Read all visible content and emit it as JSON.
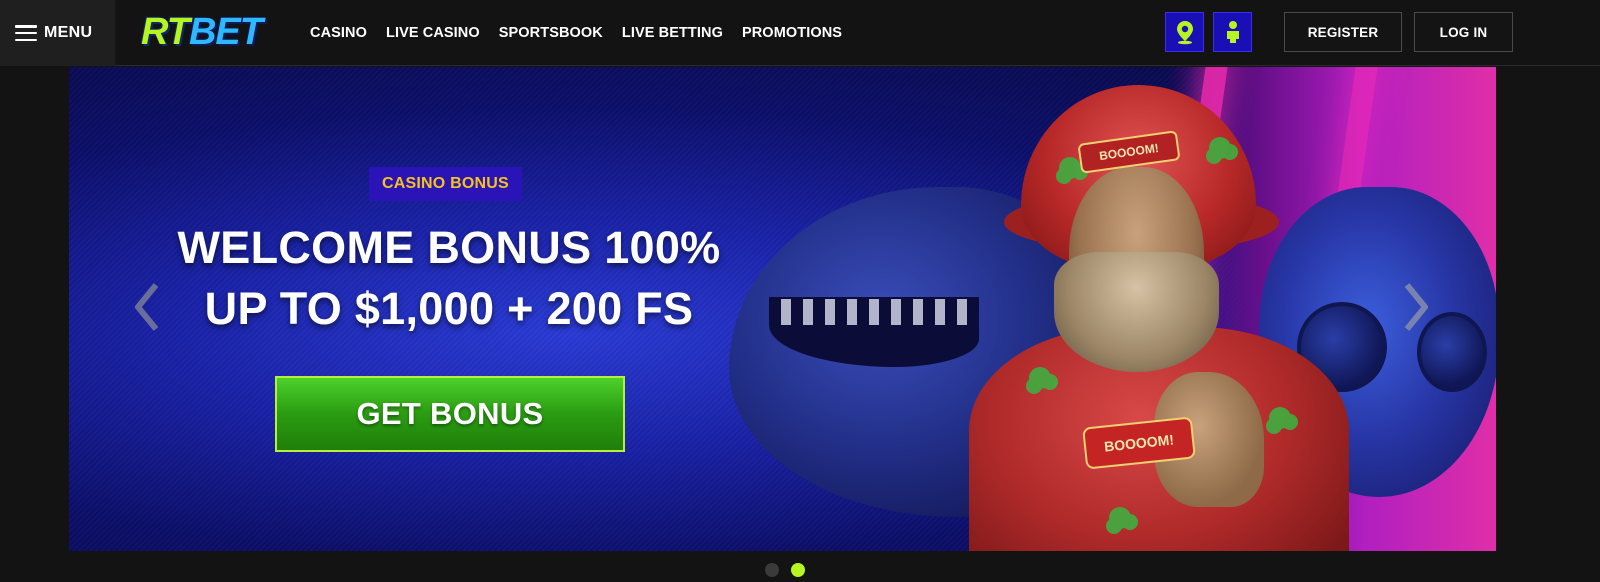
{
  "header": {
    "menu_label": "MENU",
    "logo": {
      "part1": "RT",
      "part2": "BET"
    },
    "nav": [
      {
        "label": "CASINO"
      },
      {
        "label": "LIVE CASINO"
      },
      {
        "label": "SPORTSBOOK"
      },
      {
        "label": "LIVE BETTING"
      },
      {
        "label": "PROMOTIONS"
      }
    ],
    "icons": {
      "geo": "map-pin-icon",
      "responsible": "person-icon"
    },
    "register_label": "REGISTER",
    "login_label": "LOG IN"
  },
  "hero": {
    "badge": "CASINO BONUS",
    "headline_line1": "WELCOME BONUS 100%",
    "headline_line2": "UP TO $1,000 + 200 FS",
    "cta_label": "GET BONUS",
    "tag_top": "BOOOOM!",
    "tag_chest": "BOOOOM!"
  },
  "carousel": {
    "slide_count": 2,
    "active_index": 1
  },
  "colors": {
    "accent_green": "#b7f521",
    "accent_blue": "#2fb8ff",
    "badge_bg": "#2a14b8",
    "badge_text": "#f6c21d",
    "cta_green": "#2a9c12",
    "icon_btn_bg": "#1a0fb5"
  }
}
